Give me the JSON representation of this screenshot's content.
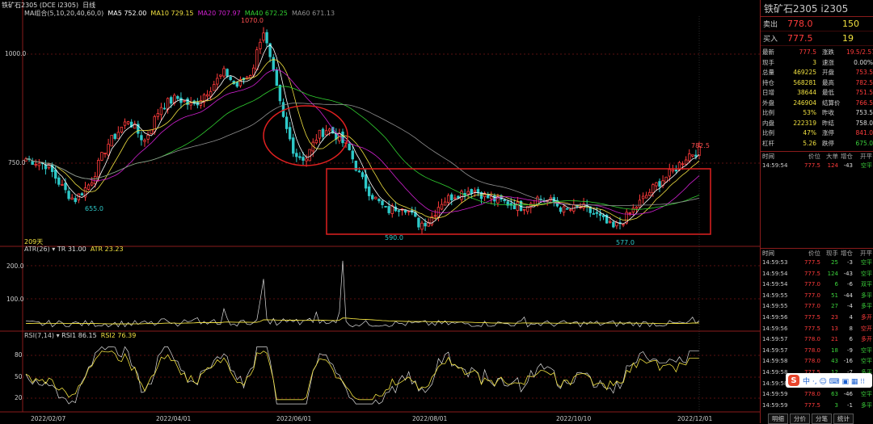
{
  "header": {
    "symbol": "铁矿石2305 (DCE i2305)",
    "period": "日线",
    "ma_group": "MA组合(5,10,20,40,60,0)",
    "ma5": "MA5 752.00",
    "ma10": "MA10 729.15",
    "ma20": "MA20 707.97",
    "ma40": "MA40 672.25",
    "ma60": "MA60 671.13"
  },
  "price_axis": {
    "l1000": "1000.0",
    "l750": "750.0"
  },
  "price_annotations": {
    "high": "1070.0",
    "low1": "655.0",
    "low2": "590.0",
    "low3": "577.0",
    "last": "782.5",
    "days": "209天"
  },
  "atr": {
    "title": "ATR(26)",
    "tr": "TR 31.00",
    "atr": "ATR 23.23",
    "y200": "200.0",
    "y100": "100.0"
  },
  "rsi": {
    "title": "RSI(7,14)",
    "rsi1": "RSI1 86.15",
    "rsi2": "RSI2 76.39",
    "y80": "80",
    "y50": "50",
    "y20": "20"
  },
  "x_axis": [
    "2022/02/07",
    "2022/04/01",
    "2022/06/01",
    "2022/08/01",
    "2022/10/10",
    "2022/12/01"
  ],
  "sidebar": {
    "title": "铁矿石2305  i2305",
    "sell": {
      "label": "卖出",
      "price": "778.0",
      "vol": "150"
    },
    "buy": {
      "label": "买入",
      "price": "777.5",
      "vol": "19"
    },
    "stats": [
      {
        "l1": "最新",
        "v1": "777.5",
        "c1": "red",
        "l2": "涨跌",
        "v2": "19.5/2.57%",
        "c2": "red"
      },
      {
        "l1": "现手",
        "v1": "3",
        "c1": "yellow",
        "l2": "速涨",
        "v2": "0.00%",
        "c2": "white"
      },
      {
        "l1": "总量",
        "v1": "469225",
        "c1": "yellow",
        "l2": "开盘",
        "v2": "753.5",
        "c2": "red"
      },
      {
        "l1": "持仓",
        "v1": "568281",
        "c1": "yellow",
        "l2": "最高",
        "v2": "782.5",
        "c2": "red"
      },
      {
        "l1": "日增",
        "v1": "38644",
        "c1": "yellow",
        "l2": "最低",
        "v2": "751.5",
        "c2": "red"
      },
      {
        "l1": "外盘",
        "v1": "246904",
        "c1": "yellow",
        "l2": "结算价",
        "v2": "766.5",
        "c2": "red"
      },
      {
        "l1": "比例",
        "v1": "53%",
        "c1": "yellow",
        "l2": "昨收",
        "v2": "753.5",
        "c2": "white"
      },
      {
        "l1": "内盘",
        "v1": "222319",
        "c1": "yellow",
        "l2": "昨结",
        "v2": "758.0",
        "c2": "white"
      },
      {
        "l1": "比例",
        "v1": "47%",
        "c1": "yellow",
        "l2": "涨停",
        "v2": "841.0",
        "c2": "red"
      },
      {
        "l1": "杠杆",
        "v1": "5.26",
        "c1": "yellow",
        "l2": "跌停",
        "v2": "675.0",
        "c2": "green"
      }
    ],
    "tick_header": {
      "time": "时间",
      "price": "价位",
      "vol": "大单",
      "chg": "增仓",
      "type": "开平"
    },
    "tick_header2": {
      "time": "时间",
      "price": "价位",
      "vol": "现手",
      "chg": "增仓",
      "type": "开平"
    },
    "big_ticks": [
      {
        "time": "14:59:54",
        "price": "777.5",
        "vol": "124",
        "chg": "-43",
        "type": "空平"
      }
    ],
    "ticks": [
      {
        "time": "14:59:53",
        "price": "777.5",
        "vol": "25",
        "chg": "-3",
        "type": "空平",
        "tc": "green"
      },
      {
        "time": "14:59:54",
        "price": "777.5",
        "vol": "124",
        "chg": "-43",
        "type": "空平",
        "tc": "green"
      },
      {
        "time": "14:59:54",
        "price": "777.0",
        "vol": "6",
        "chg": "-6",
        "type": "双平",
        "tc": "green"
      },
      {
        "time": "14:59:55",
        "price": "777.0",
        "vol": "51",
        "chg": "-44",
        "type": "多平",
        "tc": "green"
      },
      {
        "time": "14:59:55",
        "price": "777.0",
        "vol": "27",
        "chg": "-4",
        "type": "多平",
        "tc": "green"
      },
      {
        "time": "14:59:56",
        "price": "777.5",
        "vol": "23",
        "chg": "4",
        "type": "多开",
        "tc": "red"
      },
      {
        "time": "14:59:56",
        "price": "777.5",
        "vol": "13",
        "chg": "8",
        "type": "空开",
        "tc": "red"
      },
      {
        "time": "14:59:57",
        "price": "778.0",
        "vol": "21",
        "chg": "6",
        "type": "多开",
        "tc": "red"
      },
      {
        "time": "14:59:57",
        "price": "778.0",
        "vol": "18",
        "chg": "-9",
        "type": "空平",
        "tc": "green"
      },
      {
        "time": "14:59:58",
        "price": "778.0",
        "vol": "43",
        "chg": "-16",
        "type": "空平",
        "tc": "green"
      },
      {
        "time": "14:59:58",
        "price": "777.5",
        "vol": "12",
        "chg": "-7",
        "type": "多平",
        "tc": "green"
      },
      {
        "time": "14:59:58",
        "price": "777.5",
        "vol": "",
        "chg": "",
        "type": "",
        "tc": "green"
      },
      {
        "time": "14:59:59",
        "price": "778.0",
        "vol": "63",
        "chg": "-46",
        "type": "空平",
        "tc": "green"
      },
      {
        "time": "14:59:59",
        "price": "777.5",
        "vol": "3",
        "chg": "-1",
        "type": "多平",
        "tc": "green"
      }
    ],
    "tabs": [
      "明细",
      "分价",
      "分笔",
      "统计"
    ]
  },
  "ime": {
    "logo": "S",
    "text": "中 ·, ☺ ⌨ ▣ ▦ ⁝⁝"
  },
  "colors": {
    "up": "#ff3b3b",
    "down": "#2ec8c8",
    "ma5": "#ffffff",
    "ma10": "#f0e040",
    "ma20": "#d020d0",
    "ma40": "#30d030",
    "ma60": "#909090",
    "annotation": "#e02020"
  }
}
